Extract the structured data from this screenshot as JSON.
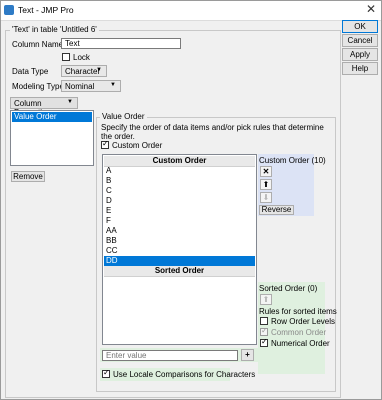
{
  "window": {
    "title": "Text - JMP Pro"
  },
  "dialog": {
    "group_title": "'Text' in table 'Untitled 6'",
    "column_name_label": "Column Name",
    "column_name_value": "Text",
    "lock_label": "Lock",
    "data_type_label": "Data Type",
    "data_type_value": "Character",
    "modeling_type_label": "Modeling Type",
    "modeling_type_value": "Nominal",
    "column_properties_label": "Column Properties",
    "properties_list": [
      "Value Order"
    ],
    "remove_label": "Remove"
  },
  "value_order": {
    "title": "Value Order",
    "description": "Specify the order of data items and/or pick rules that determine the order.",
    "custom_order_checkbox": "Custom Order",
    "custom_order_header": "Custom Order",
    "items": [
      "A",
      "B",
      "C",
      "D",
      "E",
      "F",
      "AA",
      "BB",
      "CC",
      "DD"
    ],
    "selected_item": "DD",
    "sorted_order_header": "Sorted Order",
    "custom_order_count": "Custom Order (10)",
    "reverse_label": "Reverse",
    "sorted_order_count": "Sorted Order (0)",
    "rules_label": "Rules for sorted items",
    "rule_row_order": "Row Order Levels",
    "rule_common_order": "Common Order",
    "rule_numerical_order": "Numerical Order",
    "enter_placeholder": "Enter value",
    "add_label": "+",
    "locale_label": "Use Locale Comparisons for Characters"
  },
  "buttons": {
    "ok": "OK",
    "cancel": "Cancel",
    "apply": "Apply",
    "help": "Help"
  },
  "icons": {
    "delete": "delete-x-icon",
    "move_up": "move-up-icon",
    "move_down": "move-down-icon",
    "sorted_up": "move-up-icon",
    "dropdown": "chevron-down-icon"
  },
  "colors": {
    "selection": "#0078d7",
    "custom_panel": "#dce3f5",
    "sorted_panel": "#dff0df"
  }
}
